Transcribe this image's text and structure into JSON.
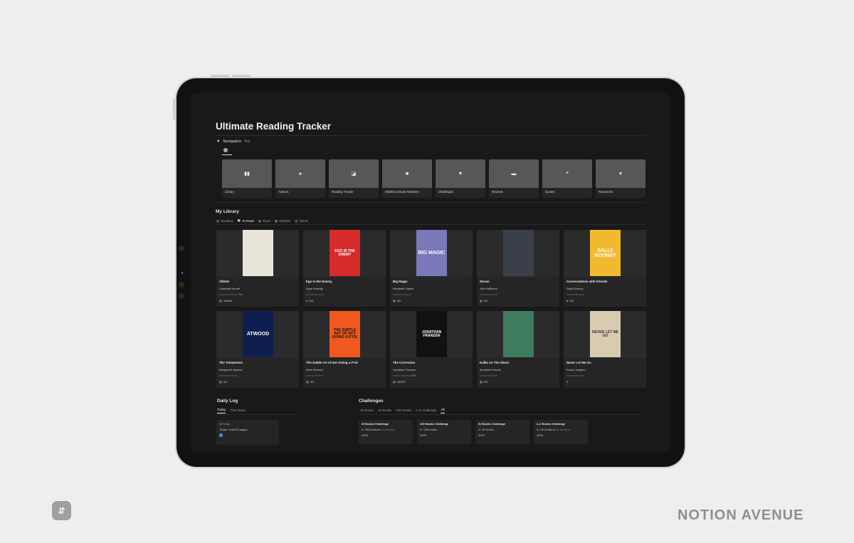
{
  "page": {
    "title": "Ultimate Reading Tracker"
  },
  "navigation": {
    "toggle_label": "Navigation",
    "toggle_suffix": "Bar",
    "items": [
      {
        "label": "Library",
        "icon": "book-open-icon",
        "glyph": "▮▮"
      },
      {
        "label": "Authors",
        "icon": "person-icon",
        "glyph": "●"
      },
      {
        "label": "Reading Tracker",
        "icon": "bookmark-icon",
        "glyph": "◪"
      },
      {
        "label": "Wishlist & Book Releases",
        "icon": "lock-icon",
        "glyph": "■"
      },
      {
        "label": "Challenges",
        "icon": "trophy-icon",
        "glyph": "▼"
      },
      {
        "label": "Reviews",
        "icon": "calendar-icon",
        "glyph": "▬"
      },
      {
        "label": "Quotes",
        "icon": "quote-icon",
        "glyph": "❝"
      },
      {
        "label": "Resources",
        "icon": "book-heart-icon",
        "glyph": "♥"
      }
    ]
  },
  "library": {
    "title": "My Library",
    "tabs": [
      {
        "label": "Reading",
        "active": false,
        "icon": "book-icon",
        "glyph": "▤"
      },
      {
        "label": "To Read",
        "active": true,
        "icon": "book-closed-icon",
        "glyph": "▣"
      },
      {
        "label": "Read",
        "active": false,
        "icon": "check-circle-icon",
        "glyph": "◉"
      },
      {
        "label": "Wishlist",
        "active": false,
        "icon": "lock-icon",
        "glyph": "▦"
      },
      {
        "label": "Series",
        "active": false,
        "icon": "stack-icon",
        "glyph": "▥"
      }
    ],
    "books": [
      {
        "title": "Villette",
        "author": "Charlotte Brontë",
        "stars": "○○○○○○○○○○ 7%",
        "pages": "40/504",
        "page_icon": "▤",
        "cover_bg": "#e8e4da",
        "cover_fg": "#222",
        "cover_text": ""
      },
      {
        "title": "Ego Is the Enemy",
        "author": "Ryan Holiday",
        "stars": "○○○○○○○○○○",
        "pages": "0/0",
        "page_icon": "●",
        "cover_bg": "#d62b2b",
        "cover_fg": "#ffffff",
        "cover_text": "EGO IS THE ENEMY"
      },
      {
        "title": "Big Magic",
        "author": "Elizabeth Gilbert",
        "stars": "○○○○○○○○○○",
        "pages": "0/0",
        "page_icon": "▤",
        "cover_bg": "#7a78b8",
        "cover_fg": "#ffffff",
        "cover_text": "BIG MAGIC"
      },
      {
        "title": "Stoner",
        "author": "John Williams",
        "stars": "○○○○○○○○○○",
        "pages": "0/0",
        "page_icon": "▤",
        "cover_bg": "#3a3f4a",
        "cover_fg": "#e8e0cf",
        "cover_text": ""
      },
      {
        "title": "Conversations with Friends",
        "author": "Sally Rooney",
        "stars": "○○○○○○○○○○",
        "pages": "0/0",
        "page_icon": "●",
        "cover_bg": "#f2b92e",
        "cover_fg": "#ffffff",
        "cover_text": "SALLY ROONEY"
      },
      {
        "title": "The Testaments",
        "author": "Margareth Atwood",
        "stars": "○○○○○○○○○○",
        "pages": "0/0",
        "page_icon": "▤",
        "cover_bg": "#0e1f4f",
        "cover_fg": "#ffffff",
        "cover_text": "ATWOOD"
      },
      {
        "title": "The Subtle Art of Not Giving a F*ck",
        "author": "Mark Manson",
        "stars": "○○○○○○○○○○",
        "pages": "0/0",
        "page_icon": "▤",
        "cover_bg": "#f0591e",
        "cover_fg": "#111111",
        "cover_text": "THE SUBTLE ART OF NOT GIVING A F*CK"
      },
      {
        "title": "The Correction",
        "author": "Jonathan Franzen",
        "stars": "○○○○○○○○○○ 6%",
        "pages": "40/597",
        "page_icon": "▤",
        "cover_bg": "#111111",
        "cover_fg": "#ffffff",
        "cover_text": "JONATHAN FRANZEN"
      },
      {
        "title": "Kafka on The Shore",
        "author": "Murakami Haruki",
        "stars": "○○○○○○○○○○",
        "pages": "0/0",
        "page_icon": "▤",
        "cover_bg": "#3e7c5e",
        "cover_fg": "#ffffff",
        "cover_text": ""
      },
      {
        "title": "Never Let Me Go",
        "author": "Kazuo Ishiguro",
        "stars": "○○○○○○○○○○",
        "pages": "0",
        "page_icon": "",
        "cover_bg": "#d8cbb0",
        "cover_fg": "#333333",
        "cover_text": "NEVER LET ME GO"
      }
    ]
  },
  "daily_log": {
    "title": "Daily Log",
    "tabs": [
      {
        "label": "Today",
        "active": true
      },
      {
        "label": "This Week",
        "active": false
      }
    ],
    "card": {
      "date": "@Today",
      "text": "Today I read 50 pages",
      "checked": true
    }
  },
  "challenges": {
    "title": "Challenges",
    "tabs": [
      {
        "label": "25 Books",
        "active": false
      },
      {
        "label": "52 Books",
        "active": false
      },
      {
        "label": "100 Books",
        "active": false
      },
      {
        "label": "A-Z Challenge",
        "active": false
      },
      {
        "label": "All",
        "active": true
      }
    ],
    "cards": [
      {
        "title": "25 Books Challenge",
        "progress": "0 / 25 books ●○○○○○○○○○",
        "year": "2023"
      },
      {
        "title": "100 Books Challenge",
        "progress": "0 / 100 books",
        "year": "2023"
      },
      {
        "title": "52 Books Challenge",
        "progress": "0 / 52 books",
        "year": "2023"
      },
      {
        "title": "A-Z Books Challenge",
        "progress": "0 / 26 books ●○○○○○○○○○",
        "year": "2023"
      }
    ]
  },
  "footer": {
    "brand": "NOTION AVENUE",
    "logo_glyph": "⇵"
  }
}
